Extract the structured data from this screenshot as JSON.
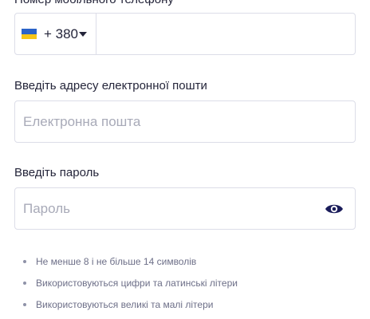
{
  "phone": {
    "label": "Номер мобільного телефону",
    "country_code": "+ 380",
    "flag_colors": [
      "#2a63c8",
      "#f5c518"
    ],
    "flag_icon": "ukraine-flag-icon",
    "dropdown_icon": "caret-down-icon",
    "value": ""
  },
  "email": {
    "label": "Введіть адресу електронної пошти",
    "placeholder": "Електронна пошта",
    "value": ""
  },
  "password": {
    "label": "Введіть пароль",
    "placeholder": "Пароль",
    "value": "",
    "toggle_icon": "eye-icon",
    "accent": "#1a1c5a"
  },
  "requirements": [
    {
      "text": "Не менше 8 і не більше 14 символів"
    },
    {
      "text": "Використовуються цифри та латинські літери"
    },
    {
      "text": "Використовуються великі та малі літери"
    }
  ]
}
